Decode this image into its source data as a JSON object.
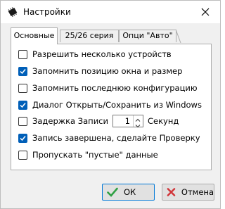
{
  "window": {
    "title": "Настройки"
  },
  "tabs": [
    {
      "label": "Основные"
    },
    {
      "label": "25/26 серия"
    },
    {
      "label": "Опци \"Авто\""
    }
  ],
  "options": [
    {
      "label": "Разрешить несколько устройств",
      "checked": false
    },
    {
      "label": "Запомнить позицию окна и размер",
      "checked": true
    },
    {
      "label": "Запомнить последнюю конфигурацию",
      "checked": false
    },
    {
      "label": "Диалог Открыть/Сохранить из Windows",
      "checked": true
    },
    {
      "label": "Задержка Записи",
      "checked": false,
      "value": "1",
      "unit": "Секунд"
    },
    {
      "label": "Запись завершена, сделайте Проверку",
      "checked": true
    },
    {
      "label": "Пропускать \"пустые\" данные",
      "checked": false
    }
  ],
  "buttons": {
    "ok": "ОК",
    "cancel": "Отмена"
  },
  "colors": {
    "accent": "#005fb8",
    "ok_icon": "#2ea043",
    "cancel_icon": "#d13438"
  },
  "icons": [
    "chip-icon",
    "close-icon",
    "check-icon",
    "cross-icon"
  ]
}
